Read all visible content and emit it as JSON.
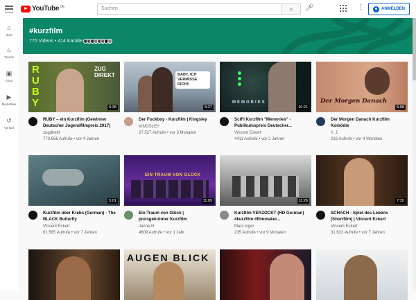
{
  "header": {
    "logo_text": "YouTube",
    "logo_sup": "DE",
    "search_placeholder": "Suchen",
    "signin_label": "ANMELDEN"
  },
  "nav": [
    {
      "label": "Start",
      "icon": "home-icon"
    },
    {
      "label": "Trends",
      "icon": "flame-icon"
    },
    {
      "label": "Abos",
      "icon": "subscriptions-icon"
    },
    {
      "label": "Mediathek",
      "icon": "library-icon"
    },
    {
      "label": "Verlauf",
      "icon": "history-icon"
    }
  ],
  "banner": {
    "title": "#kurzfilm",
    "stats": "770 Videos • 414 Kanäle",
    "color": "#0b8667"
  },
  "videos": [
    {
      "title": "RUBY – ein Kurzfilm (Gewinner Deutscher Jugendfilmpreis 2017)",
      "channel": "zugdirekt",
      "meta": "773.656 Aufrufe • vor 4 Jahren",
      "duration": "6:36"
    },
    {
      "title": "Der Fuckboy - Kurzfilm | Kingsley",
      "channel": "KINGSLEY",
      "meta": "27.527 Aufrufe • vor 3 Monaten",
      "duration": "5:27"
    },
    {
      "title": "SciFi Kurzfilm \"Memories\" - Publikumspreis Deutscher...",
      "channel": "Vincent Eckert",
      "meta": "4411 Aufrufe • vor 2 Jahren",
      "duration": "10:21"
    },
    {
      "title": "Der Morgen Danach Kurzfilm Komödie",
      "channel": "Y. J.",
      "meta": "216 Aufrufe • vor 4 Monaten",
      "duration": "6:58"
    },
    {
      "title": "Kurzfilm über Krebs (German) - The BLACK Butterfly",
      "channel": "Vincent Eckert",
      "meta": "61.585 Aufrufe • vor 7 Jahren",
      "duration": "5:01"
    },
    {
      "title": "Ein Traum von Glück | preisgekrönter Kurzfilm",
      "channel": "Janne H",
      "meta": "4609 Aufrufe • vor 1 Jahr",
      "duration": "11:09"
    },
    {
      "title": "Kurzfilm VERZOCKT (HD German) #kurzfilm #filmmaker...",
      "channel": "Marc.inger",
      "meta": "235 Aufrufe • vor 9 Monaten",
      "duration": "11:26"
    },
    {
      "title": "SCHACH - Spiel des Lebens (Shortfilm) | Vincent Eckert",
      "channel": "Vincent Eckert",
      "meta": "31.632 Aufrufe • vor 7 Jahren",
      "duration": "7:20"
    }
  ],
  "thumb_text": {
    "ruby": "RUBY",
    "zug": "ZUG DIREKT",
    "fuckboy": "BABY, ICH VERMISSE DICH!!",
    "memories": "MEMORIES",
    "morgen": "Der Morgen Danach",
    "traum": "EIN TRAUM VON GLÜCK",
    "augen": "AUGEN BLICK"
  }
}
